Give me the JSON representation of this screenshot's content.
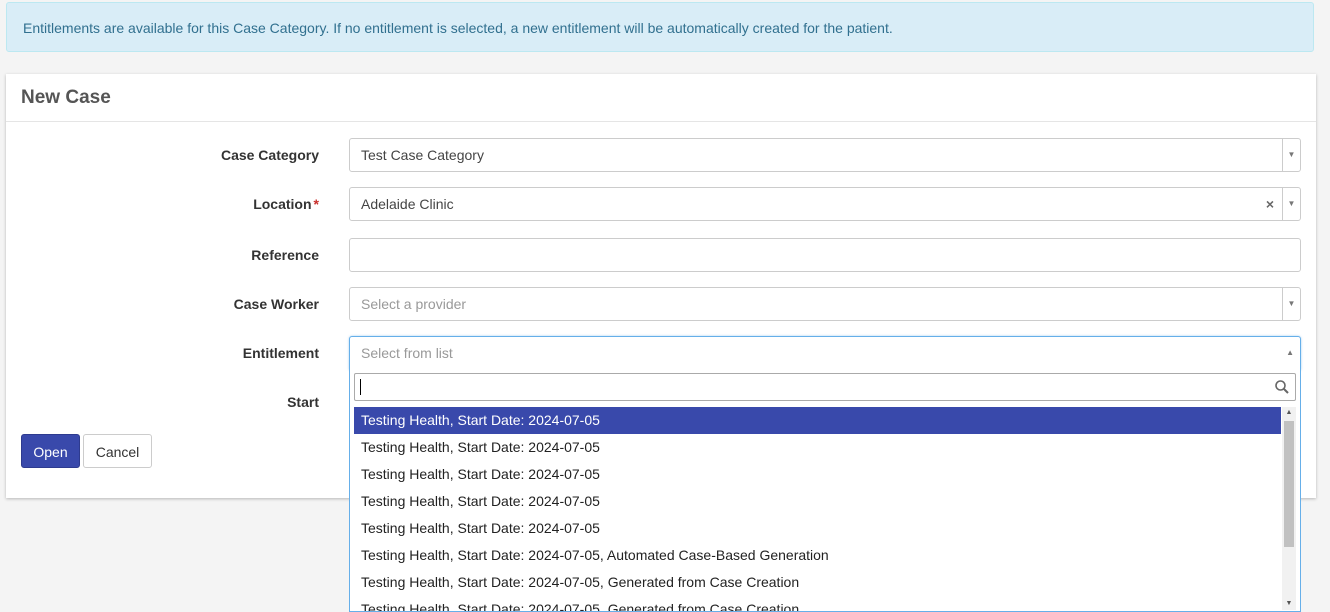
{
  "alert": {
    "message": "Entitlements are available for this Case Category. If no entitlement is selected, a new entitlement will be automatically created for the patient."
  },
  "panel": {
    "title": "New Case"
  },
  "form": {
    "case_category": {
      "label": "Case Category",
      "value": "Test Case Category"
    },
    "location": {
      "label": "Location",
      "required_mark": "*",
      "value": "Adelaide Clinic",
      "clear_glyph": "×"
    },
    "reference": {
      "label": "Reference",
      "value": ""
    },
    "case_worker": {
      "label": "Case Worker",
      "placeholder": "Select a provider"
    },
    "entitlement": {
      "label": "Entitlement",
      "placeholder": "Select from list"
    },
    "start": {
      "label": "Start"
    }
  },
  "buttons": {
    "open": "Open",
    "cancel": "Cancel"
  },
  "dropdown": {
    "search_value": "",
    "options": [
      "Testing Health, Start Date: 2024-07-05",
      "Testing Health, Start Date: 2024-07-05",
      "Testing Health, Start Date: 2024-07-05",
      "Testing Health, Start Date: 2024-07-05",
      "Testing Health, Start Date: 2024-07-05",
      "Testing Health, Start Date: 2024-07-05, Automated Case-Based Generation",
      "Testing Health, Start Date: 2024-07-05, Generated from Case Creation",
      "Testing Health, Start Date: 2024-07-05, Generated from Case Creation"
    ],
    "highlighted_index": 0
  },
  "colors": {
    "primary": "#3949ab",
    "alert_bg": "#d9edf7",
    "alert_text": "#31708f",
    "required": "#c9302c",
    "focus_border": "#66afe9"
  },
  "icons": {
    "select_arrow": "chevron-down-icon",
    "open_arrow": "chevron-up-icon",
    "search": "search-icon",
    "clear": "close-icon"
  }
}
